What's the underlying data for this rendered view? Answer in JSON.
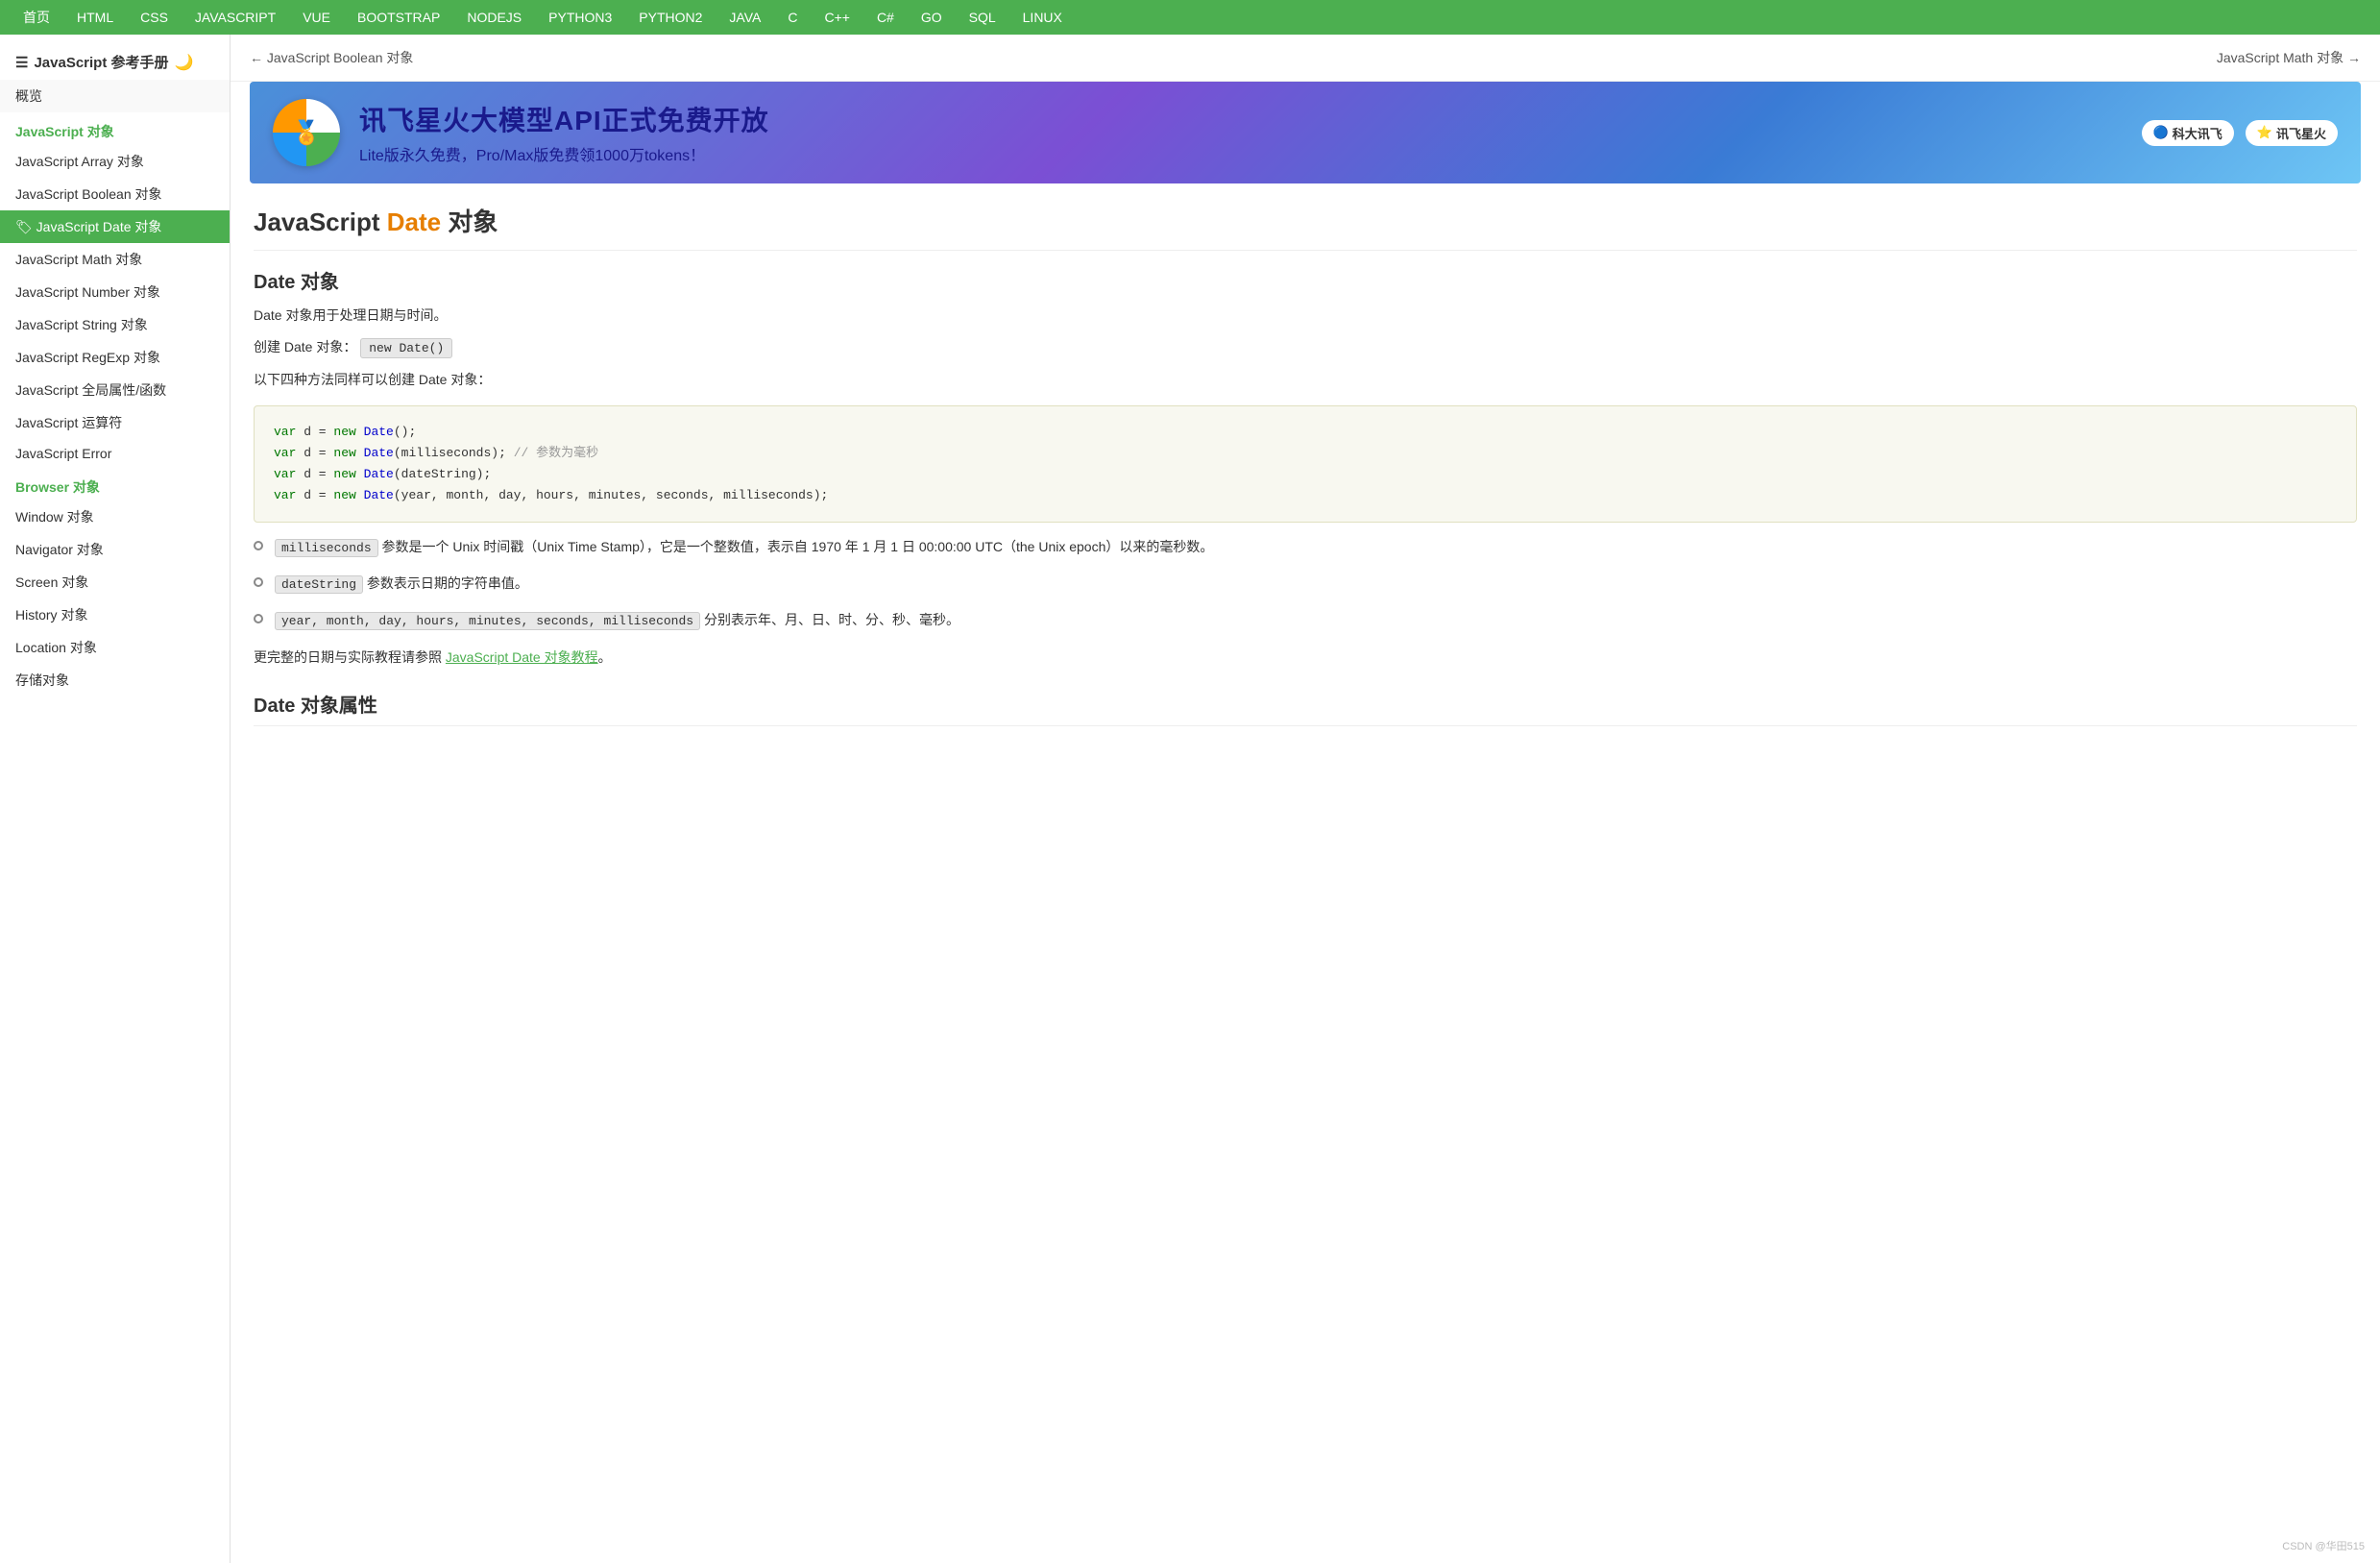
{
  "topnav": {
    "items": [
      "首页",
      "HTML",
      "CSS",
      "JAVASCRIPT",
      "VUE",
      "BOOTSTRAP",
      "NODEJS",
      "PYTHON3",
      "PYTHON2",
      "JAVA",
      "C",
      "C++",
      "C#",
      "GO",
      "SQL",
      "LINUX"
    ]
  },
  "sidebar": {
    "title": "JavaScript 参考手册",
    "overview": "概览",
    "section1": {
      "label": "JavaScript 对象",
      "items": [
        "JavaScript Array 对象",
        "JavaScript Boolean 对象",
        "JavaScript Date 对象",
        "JavaScript Math 对象",
        "JavaScript Number 对象",
        "JavaScript String 对象",
        "JavaScript RegExp 对象",
        "JavaScript 全局属性/函数",
        "JavaScript 运算符",
        "JavaScript Error"
      ]
    },
    "section2": {
      "label": "Browser 对象",
      "items": [
        "Window 对象",
        "Navigator 对象",
        "Screen 对象",
        "History 对象",
        "Location 对象",
        "存储对象"
      ]
    }
  },
  "pagenav": {
    "prev": "← JavaScript Boolean 对象",
    "next": "JavaScript Math 对象 →"
  },
  "banner": {
    "title": "讯飞星火大模型API正式免费开放",
    "subtitle": "Lite版永久免费，Pro/Max版免费领1000万tokens！",
    "brand1": "科大讯飞",
    "brand2": "讯飞星火"
  },
  "content": {
    "page_title_part1": "JavaScript ",
    "page_title_highlight": "Date",
    "page_title_part2": " 对象",
    "section1_title": "Date 对象",
    "desc1": "Date 对象用于处理日期与时间。",
    "desc2_prefix": "创建 Date 对象：",
    "inline_code": "new Date()",
    "desc3": "以下四种方法同样可以创建 Date 对象：",
    "code": {
      "line1": "var d = new Date();",
      "line2": "var d = new Date(milliseconds); // 参数为毫秒",
      "line3": "var d = new Date(dateString);",
      "line4": "var d = new Date(year, month, day, hours, minutes, seconds, milliseconds);"
    },
    "bullets": [
      {
        "param": "milliseconds",
        "text": " 参数是一个 Unix 时间戳（Unix Time Stamp），它是一个整数值，表示自 1970 年 1 月 1 日 00:00:00 UTC（the Unix epoch）以来的毫秒数。"
      },
      {
        "param": "dateString",
        "text": " 参数表示日期的字符串值。"
      },
      {
        "param": "year, month, day, hours, minutes, seconds, milliseconds",
        "text": " 分别表示年、月、日、时、分、秒、毫秒。"
      }
    ],
    "link_prefix": "更完整的日期与实际教程请参照 ",
    "link_text": "JavaScript Date 对象教程",
    "link_suffix": "。",
    "section2_title": "Date 对象属性"
  },
  "watermark": "CSDN @华田515"
}
